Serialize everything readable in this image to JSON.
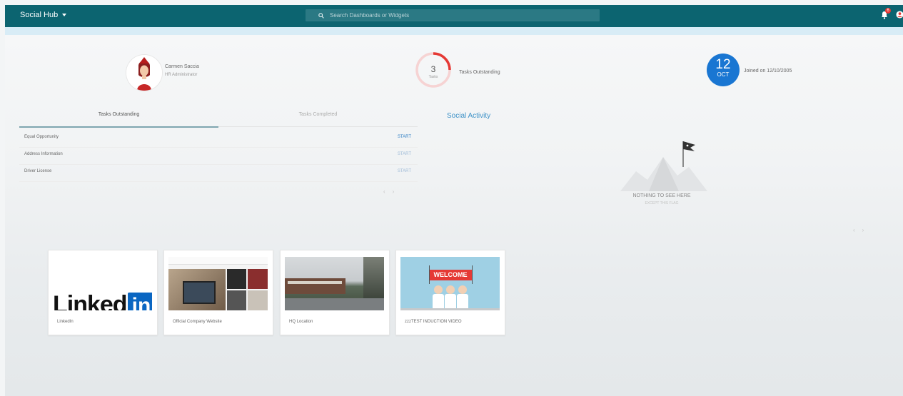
{
  "header": {
    "app_title": "Social Hub",
    "search_placeholder": "Search Dashboards or Widgets",
    "notification_count": "6"
  },
  "profile": {
    "name": "Carmen Saccia",
    "role": "HR Administrator"
  },
  "tasks_summary": {
    "count": "3",
    "unit": "Tasks",
    "label": "Tasks Outstanding",
    "progress_fraction": 0.25
  },
  "joined": {
    "day": "12",
    "month": "OCT",
    "text": "Joined on 12/10/2005"
  },
  "tabs": {
    "outstanding": "Tasks Outstanding",
    "completed": "Tasks Completed"
  },
  "tasks": [
    {
      "name": "Equal Opportunity",
      "action": "START"
    },
    {
      "name": "Address Information",
      "action": "START"
    },
    {
      "name": "Driver License",
      "action": "START"
    }
  ],
  "social": {
    "title": "Social Activity",
    "empty_title": "NOTHING TO SEE HERE",
    "empty_sub": "EXCEPT THIS FLAG"
  },
  "cards": [
    {
      "label": "LinkedIn",
      "logo_text": "Linked"
    },
    {
      "label": "Official Company Website"
    },
    {
      "label": "HQ Location"
    },
    {
      "label": "zzzTEST INDUCTION VIDEO",
      "banner_text": "WELCOME"
    }
  ],
  "colors": {
    "topbar": "#0c6470",
    "accent_blue": "#1976d2",
    "ring_red": "#e53935",
    "linkedin_blue": "#0a66c2"
  }
}
